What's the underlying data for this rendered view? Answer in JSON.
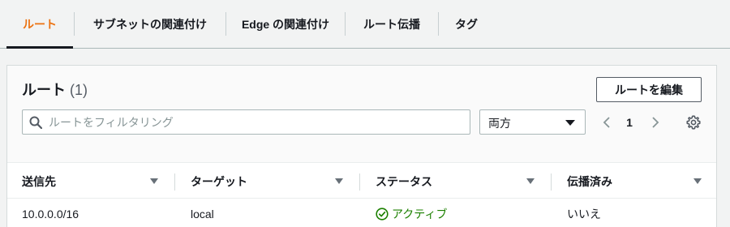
{
  "tabs": [
    {
      "label": "ルート",
      "active": true
    },
    {
      "label": "サブネットの関連付け",
      "active": false
    },
    {
      "label": "Edge の関連付け",
      "active": false
    },
    {
      "label": "ルート伝播",
      "active": false
    },
    {
      "label": "タグ",
      "active": false
    }
  ],
  "panel": {
    "title": "ルート",
    "count": "(1)",
    "edit_button": "ルートを編集"
  },
  "search": {
    "placeholder": "ルートをフィルタリング",
    "value": "",
    "icon": "search-icon"
  },
  "filter_select": {
    "value": "両方"
  },
  "pagination": {
    "current_page": "1"
  },
  "table": {
    "columns": [
      "送信先",
      "ターゲット",
      "ステータス",
      "伝播済み"
    ],
    "rows": [
      {
        "destination": "10.0.0.0/16",
        "target": "local",
        "status": "アクティブ",
        "propagated": "いいえ"
      }
    ]
  },
  "colors": {
    "accent": "#ec7211",
    "status_active": "#1d8102"
  }
}
